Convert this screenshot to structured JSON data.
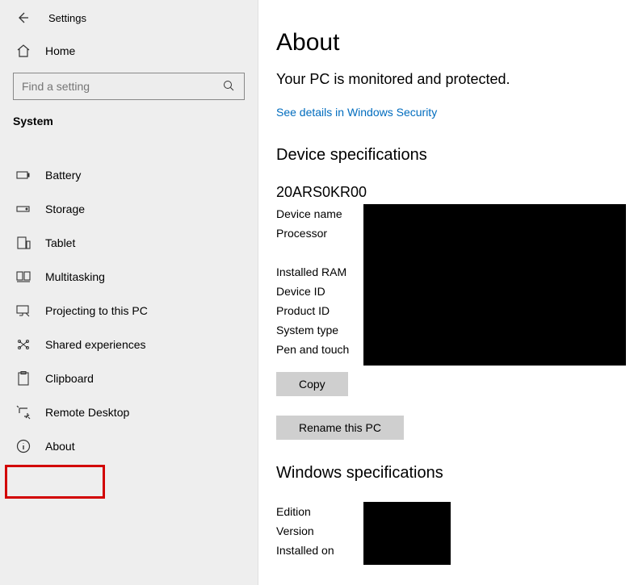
{
  "header": {
    "title": "Settings"
  },
  "home_label": "Home",
  "search": {
    "placeholder": "Find a setting"
  },
  "category": "System",
  "sidebar": {
    "items": [
      {
        "label": "Battery"
      },
      {
        "label": "Storage"
      },
      {
        "label": "Tablet"
      },
      {
        "label": "Multitasking"
      },
      {
        "label": "Projecting to this PC"
      },
      {
        "label": "Shared experiences"
      },
      {
        "label": "Clipboard"
      },
      {
        "label": "Remote Desktop"
      },
      {
        "label": "About"
      }
    ]
  },
  "main": {
    "heading": "About",
    "status": "Your PC is monitored and protected.",
    "security_link": "See details in Windows Security",
    "device_spec_title": "Device specifications",
    "device_name_value": "20ARS0KR00",
    "device_labels": {
      "device_name": "Device name",
      "processor": "Processor",
      "installed_ram": "Installed RAM",
      "device_id": "Device ID",
      "product_id": "Product ID",
      "system_type": "System type",
      "pen_touch": "Pen and touch"
    },
    "copy_label": "Copy",
    "rename_label": "Rename this PC",
    "win_spec_title": "Windows specifications",
    "win_labels": {
      "edition": "Edition",
      "version": "Version",
      "installed_on": "Installed on"
    }
  }
}
